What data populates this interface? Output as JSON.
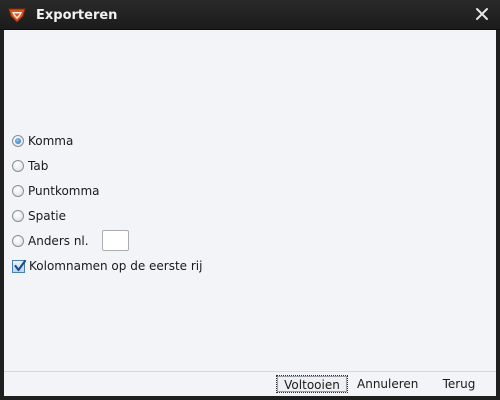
{
  "window": {
    "title": "Exporteren"
  },
  "options": [
    {
      "label": "Komma",
      "checked": true
    },
    {
      "label": "Tab",
      "checked": false
    },
    {
      "label": "Puntkomma",
      "checked": false
    },
    {
      "label": "Spatie",
      "checked": false
    },
    {
      "label": "Anders nl.",
      "checked": false
    }
  ],
  "other_value": "",
  "header_checkbox": {
    "label": "Kolomnamen op de eerste rij",
    "checked": true
  },
  "buttons": {
    "finish": "Voltooien",
    "cancel": "Annuleren",
    "back": "Terug"
  },
  "colors": {
    "titlebar": "#1b1b1b",
    "content_bg": "#f2f4f7",
    "accent": "#2a6fb5"
  }
}
